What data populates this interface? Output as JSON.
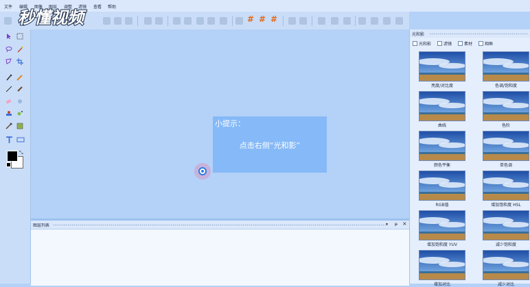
{
  "menu": [
    "文件",
    "编辑",
    "图像",
    "图层",
    "调整",
    "滤镜",
    "查看",
    "帮助"
  ],
  "logo_text": "秒懂视频",
  "hint": {
    "title": "小提示：",
    "body": "点击右侧“光和影”"
  },
  "layers_panel": {
    "title": "图层列表",
    "pin": "▾",
    "float": "ᵽ",
    "close": "×"
  },
  "right_panel": {
    "title": "光和影",
    "tabs": [
      "光和影",
      "滤镜",
      "素材",
      "相框"
    ],
    "items": [
      {
        "label": "亮度/对比度"
      },
      {
        "label": "色调/饱和度"
      },
      {
        "label": "曲线"
      },
      {
        "label": "色阶"
      },
      {
        "label": "颜色平衡"
      },
      {
        "label": "单色调"
      },
      {
        "label": "RGB值"
      },
      {
        "label": "增加饱和度 HSL"
      },
      {
        "label": "增加饱和度 YUV"
      },
      {
        "label": "减少饱和度"
      },
      {
        "label": "增加对比"
      },
      {
        "label": "减少对比"
      }
    ]
  },
  "colors": {
    "accent": "#2a7be0",
    "hint_bg": "#85b9f8",
    "hash_icon": "#e26a1f"
  }
}
